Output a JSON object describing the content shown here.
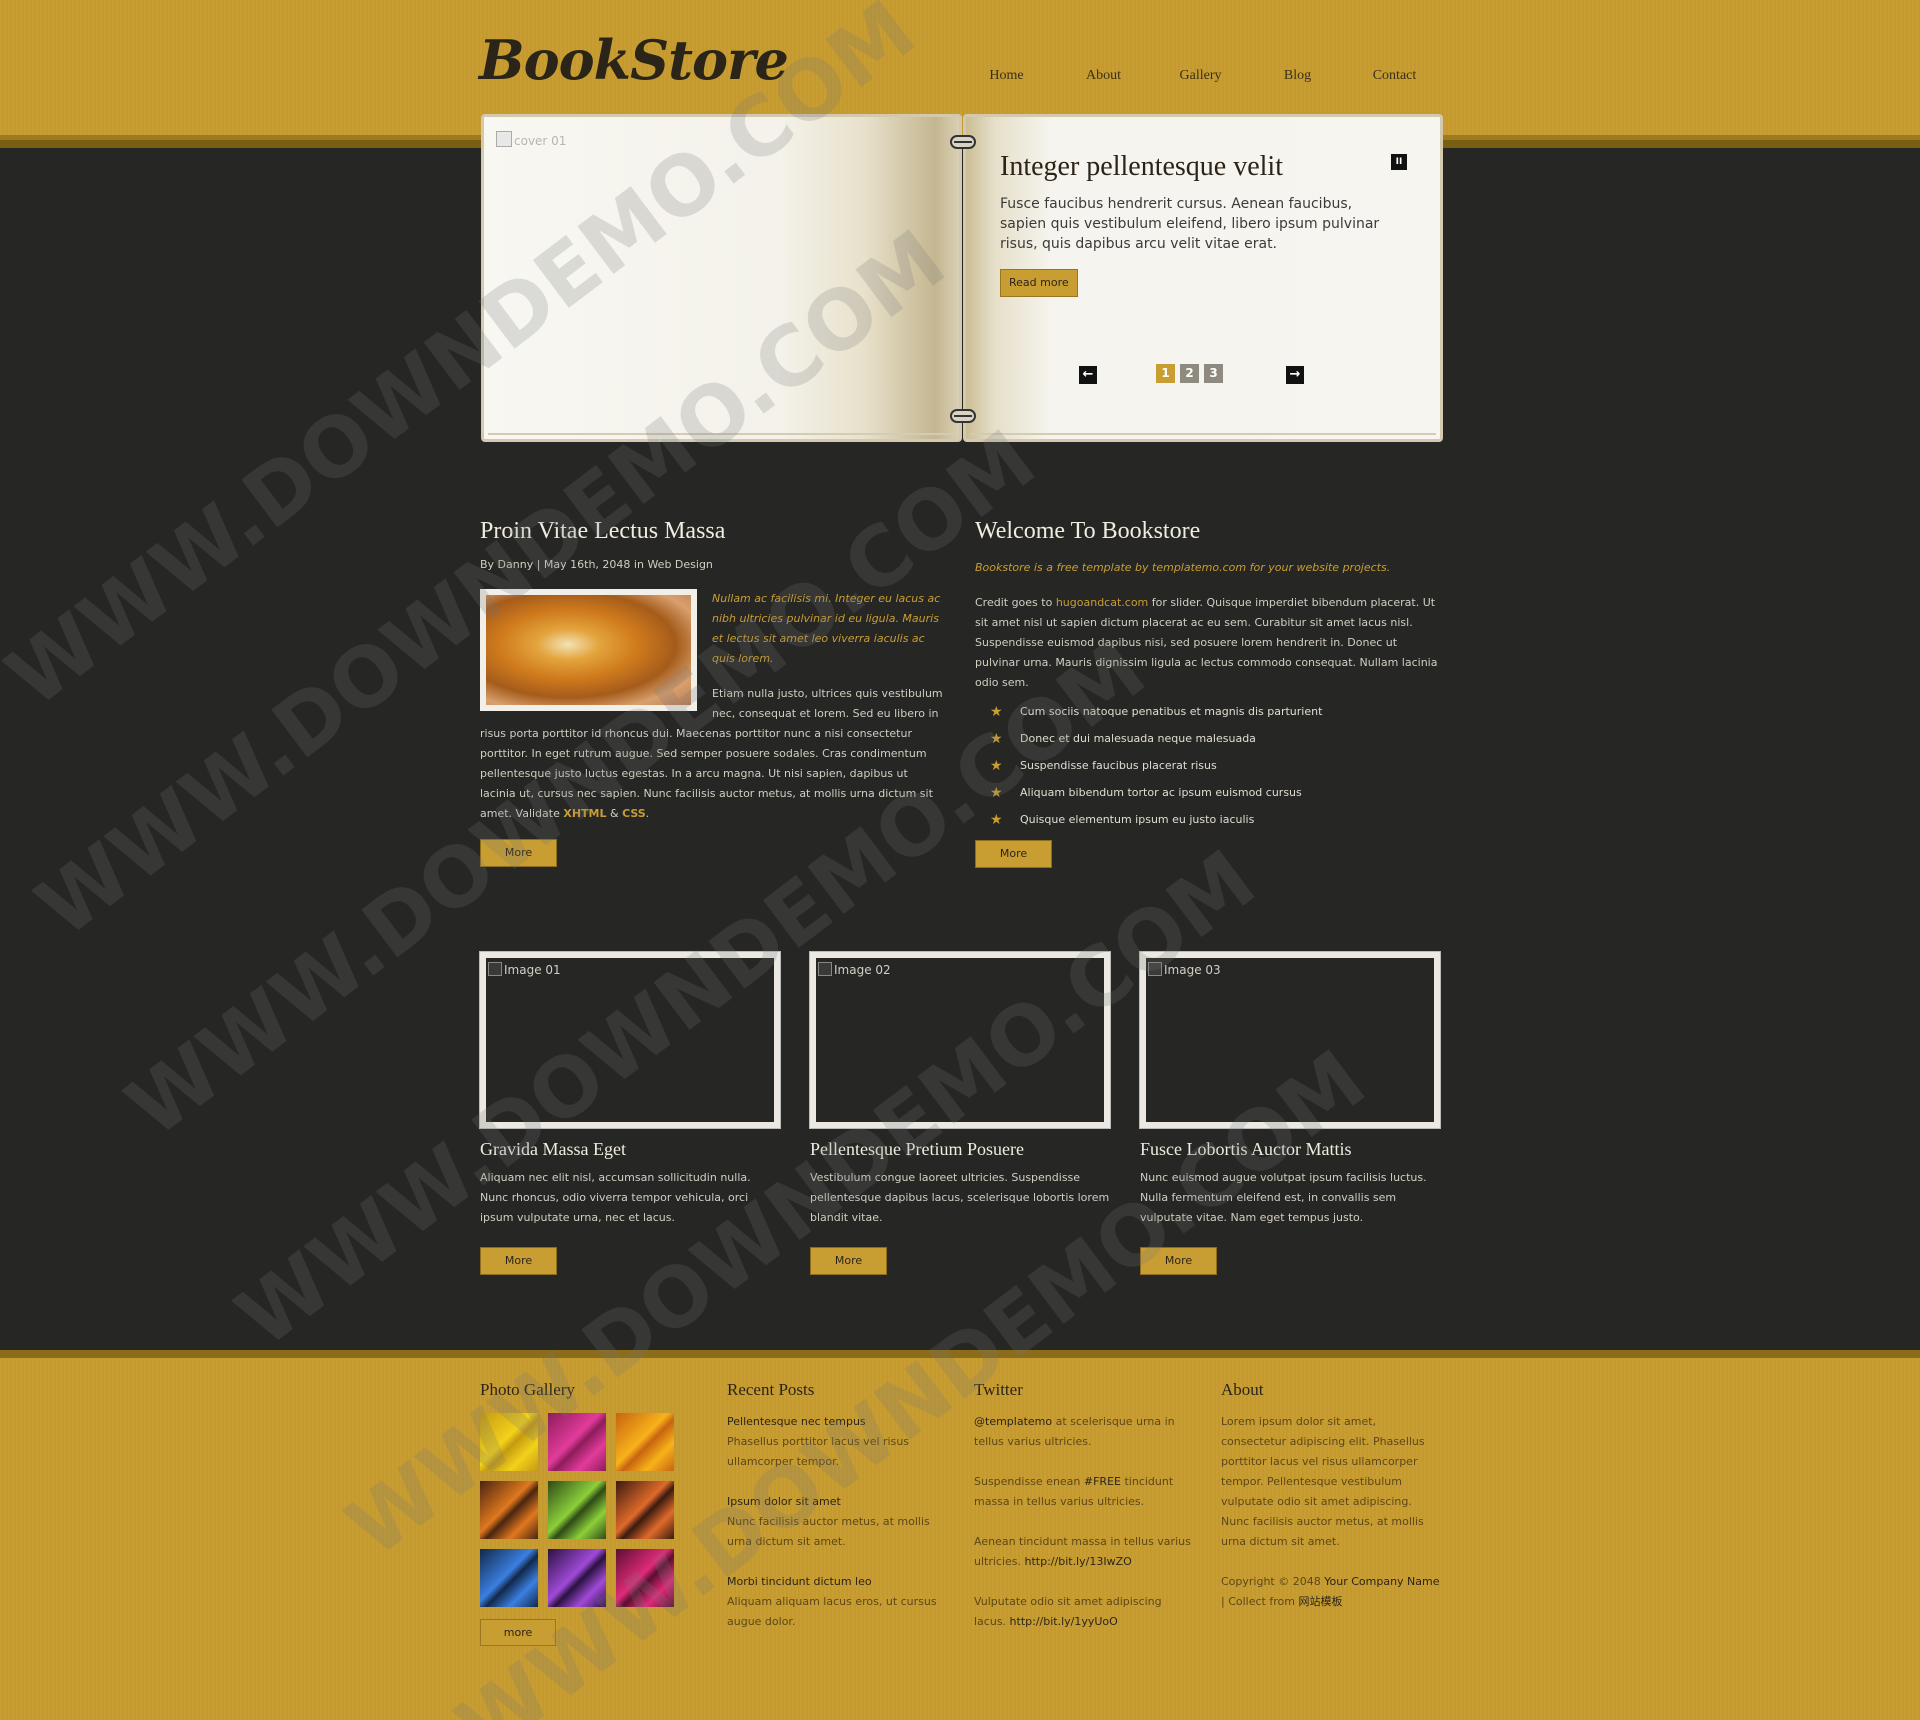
{
  "header": {
    "logo": "BookStore",
    "nav": [
      "Home",
      "About",
      "Gallery",
      "Blog",
      "Contact"
    ]
  },
  "slider": {
    "image_alt": "cover 01",
    "title": "Integer pellentesque velit",
    "text": "Fusce faucibus hendrerit cursus. Aenean faucibus, sapien quis vestibulum eleifend, libero ipsum pulvinar risus, quis dapibus arcu velit vitae erat.",
    "button": "Read more",
    "pause": "II",
    "prev": "←",
    "next": "→",
    "pages": [
      "1",
      "2",
      "3"
    ],
    "active_page": 1
  },
  "post": {
    "title": "Proin Vitae Lectus Massa",
    "meta": "By Danny | May 16th, 2048 in Web Design",
    "intro": "Nullam ac facilisis mi. Integer eu lacus ac nibh ultricies pulvinar id eu ligula. Mauris et lectus sit amet leo viverra iaculis ac quis lorem.",
    "body": "Etiam nulla justo, ultrices quis vestibulum nec, consequat et lorem. Sed eu libero in risus porta porttitor id rhoncus dui. Maecenas porttitor nunc a nisi consectetur porttitor. In eget rutrum augue. Sed semper posuere sodales. Cras condimentum pellentesque justo luctus egestas. In a arcu magna. Ut nisi sapien, dapibus ut lacinia ut, cursus nec sapien. Nunc facilisis auctor metus, at mollis urna dictum sit amet. Validate ",
    "link_xhtml": "XHTML",
    "amp": " & ",
    "link_css": "CSS",
    "end": ".",
    "button": "More"
  },
  "welcome": {
    "title": "Welcome To Bookstore",
    "intro": "Bookstore is a free template by templatemo.com for your website projects.",
    "body_pre": "Credit goes to ",
    "body_link": "hugoandcat.com",
    "body_post": " for slider. Quisque imperdiet bibendum placerat. Ut sit amet nisl ut sapien dictum placerat ac eu sem. Curabitur sit amet lacus nisl. Suspendisse euismod dapibus nisi, sed posuere lorem hendrerit in. Donec ut pulvinar urna. Mauris dignissim ligula ac lectus commodo consequat. Nullam lacinia odio sem.",
    "list": [
      "Cum sociis natoque penatibus et magnis dis parturient",
      "Donec et dui malesuada neque malesuada",
      "Suspendisse faucibus placerat risus",
      "Aliquam bibendum tortor ac ipsum euismod cursus",
      "Quisque elementum ipsum eu justo iaculis"
    ],
    "button": "More"
  },
  "cards": [
    {
      "image_alt": "Image 01",
      "title": "Gravida Massa Eget",
      "text": "Aliquam nec elit nisl, accumsan sollicitudin nulla. Nunc rhoncus, odio viverra tempor vehicula, orci ipsum vulputate urna, nec et lacus.",
      "button": "More"
    },
    {
      "image_alt": "Image 02",
      "title": "Pellentesque Pretium Posuere",
      "text": "Vestibulum congue laoreet ultricies. Suspendisse pellentesque dapibus lacus, scelerisque lobortis lorem blandit vitae.",
      "button": "More"
    },
    {
      "image_alt": "Image 03",
      "title": "Fusce Lobortis Auctor Mattis",
      "text": "Nunc euismod augue volutpat ipsum facilisis luctus. Nulla fermentum eleifend est, in convallis sem vulputate vitae. Nam eget tempus justo.",
      "button": "More"
    }
  ],
  "footer": {
    "gallery": {
      "title": "Photo Gallery",
      "thumb_colors": [
        [
          "#f2d21a",
          "#c49a12"
        ],
        [
          "#e23b9a",
          "#8e1c5c"
        ],
        [
          "#f7b21a",
          "#c86410"
        ],
        [
          "#e0781e",
          "#4a2510"
        ],
        [
          "#8ccf3a",
          "#2e4a16"
        ],
        [
          "#e06a2a",
          "#3a1a10"
        ],
        [
          "#3a7fe0",
          "#12284a"
        ],
        [
          "#a04ad8",
          "#2a1240"
        ],
        [
          "#e02a7a",
          "#5a0f30"
        ]
      ],
      "button": "more"
    },
    "recent": {
      "title": "Recent Posts",
      "posts": [
        {
          "title": "Pellentesque nec tempus",
          "text": "Phasellus porttitor lacus vel risus ullamcorper tempor."
        },
        {
          "title": "Ipsum dolor sit amet",
          "text": "Nunc facilisis auctor metus, at mollis urna dictum sit amet."
        },
        {
          "title": "Morbi tincidunt dictum leo",
          "text": "Aliquam aliquam lacus eros, ut cursus augue dolor."
        }
      ]
    },
    "twitter": {
      "title": "Twitter",
      "tweets": [
        {
          "pre": "",
          "link": "@templatemo",
          "post": " at scelerisque urna in tellus varius ultricies."
        },
        {
          "pre": "Suspendisse enean ",
          "link": "#FREE",
          "post": " tincidunt massa in tellus varius ultricies."
        },
        {
          "pre": "Aenean tincidunt massa in tellus varius ultricies. ",
          "link": "http://bit.ly/13IwZO",
          "post": ""
        },
        {
          "pre": "Vulputate odio sit amet adipiscing lacus. ",
          "link": "http://bit.ly/1yyUoO",
          "post": ""
        }
      ]
    },
    "about": {
      "title": "About",
      "text": "Lorem ipsum dolor sit amet, consectetur adipiscing elit. Phasellus porttitor lacus vel risus ullamcorper tempor. Pellentesque vestibulum vulputate odio sit amet adipiscing. Nunc facilisis auctor metus, at mollis urna dictum sit amet.",
      "copyright_pre": "Copyright © 2048 ",
      "company": "Your Company Name",
      "sep": " | Collect from ",
      "collect": "网站模板"
    }
  },
  "watermark": "WWW.DOWNDEMO.COM",
  "colors": {
    "gold": "#c89e33",
    "dark": "#262624",
    "brown": "#2b2418"
  }
}
